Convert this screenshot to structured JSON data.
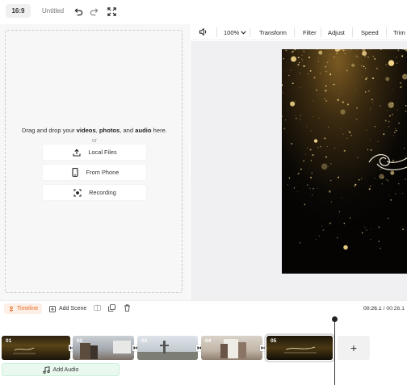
{
  "header": {
    "aspect_ratio": "16:9",
    "title": "Untitled",
    "undo_icon": "undo-icon",
    "redo_icon": "redo-icon",
    "fullscreen_icon": "fullscreen-icon"
  },
  "upload": {
    "drop_prefix": "Drag and drop your",
    "drop_videos": "videos",
    "drop_sep1": ",",
    "drop_photos": "photos",
    "drop_sep2": ", and",
    "drop_audio": "audio",
    "drop_suffix": "here.",
    "or": "or",
    "buttons": [
      {
        "label": "Local Files",
        "icon": "upload-icon"
      },
      {
        "label": "From Phone",
        "icon": "phone-icon"
      },
      {
        "label": "Recording",
        "icon": "record-icon"
      }
    ]
  },
  "toolbar": {
    "volume_icon": "volume-icon",
    "zoom": "100%",
    "items": [
      "Transform",
      "Filter",
      "Adjust",
      "Speed",
      "Trim"
    ]
  },
  "timeline": {
    "tab_label": "Timeline",
    "add_scene_label": "Add Scene",
    "current_time": "00:26.1",
    "separator": " / ",
    "total_time": "00:26.1",
    "clips": [
      {
        "number": "01"
      },
      {
        "number": "02"
      },
      {
        "number": "03"
      },
      {
        "number": "04"
      },
      {
        "number": "05"
      }
    ],
    "add_clip_label": "+",
    "add_audio_label": "Add Audio"
  },
  "colors": {
    "accent": "#e8702a",
    "audio_track": "#e9f9ef"
  }
}
